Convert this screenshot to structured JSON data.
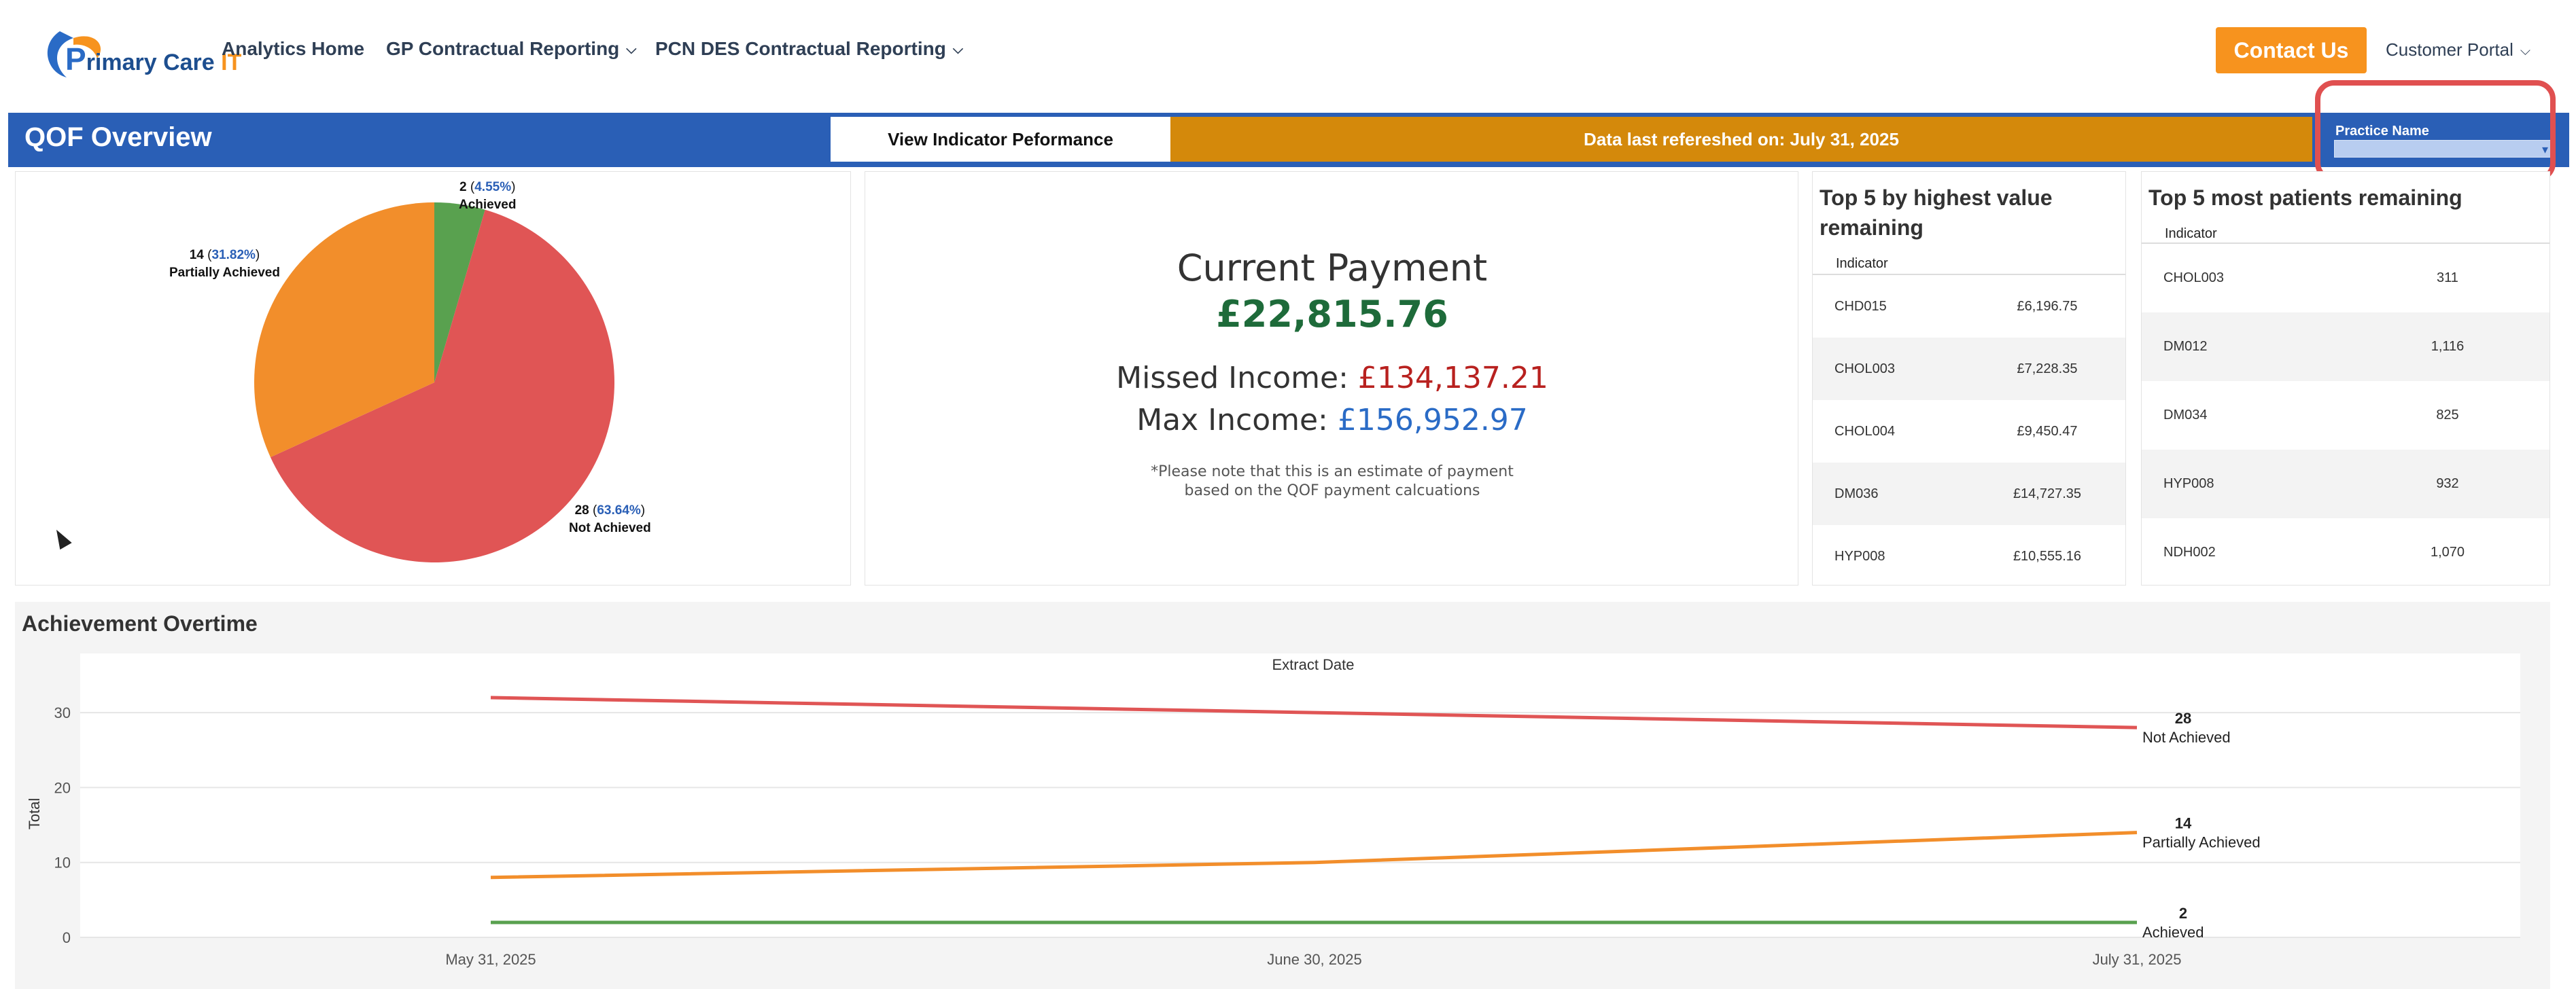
{
  "nav": {
    "logo_text": "rimary Care",
    "logo_it": "IT",
    "links": [
      "Analytics Home",
      "GP Contractual Reporting",
      "PCN DES Contractual Reporting"
    ],
    "contact_label": "Contact Us",
    "portal_label": "Customer Portal"
  },
  "banner": {
    "title": "QOF Overview",
    "view_button": "View Indicator Peformance",
    "refresh_text": "Data last refereshed on: July 31, 2025",
    "practice_label": "Practice Name",
    "practice_value": ""
  },
  "pie": {
    "achieved": {
      "count": "2",
      "pct": "4.55%",
      "label": "Achieved"
    },
    "partial": {
      "count": "14",
      "pct": "31.82%",
      "label": "Partially Achieved"
    },
    "not": {
      "count": "28",
      "pct": "63.64%",
      "label": "Not Achieved"
    }
  },
  "payment": {
    "current_label": "Current Payment",
    "current_value": "£22,815.76",
    "missed_label": "Missed Income: ",
    "missed_value": "£134,137.21",
    "max_label": "Max Income: ",
    "max_value": "£156,952.97",
    "note_line1": "*Please note that this is an estimate of payment",
    "note_line2": "based on the QOF payment calcuations"
  },
  "top5_value": {
    "title": "Top 5 by highest value remaining",
    "header": "Indicator",
    "rows": [
      {
        "indicator": "CHD015",
        "value": "£6,196.75"
      },
      {
        "indicator": "CHOL003",
        "value": "£7,228.35"
      },
      {
        "indicator": "CHOL004",
        "value": "£9,450.47"
      },
      {
        "indicator": "DM036",
        "value": "£14,727.35"
      },
      {
        "indicator": "HYP008",
        "value": "£10,555.16"
      }
    ]
  },
  "top5_patients": {
    "title": "Top 5 most patients remaining",
    "header": "Indicator",
    "rows": [
      {
        "indicator": "CHOL003",
        "value": "311"
      },
      {
        "indicator": "DM012",
        "value": "1,116"
      },
      {
        "indicator": "DM034",
        "value": "825"
      },
      {
        "indicator": "HYP008",
        "value": "932"
      },
      {
        "indicator": "NDH002",
        "value": "1,070"
      }
    ]
  },
  "achievement": {
    "title": "Achievement Overtime"
  },
  "colors": {
    "not_achieved": "#e05555",
    "partial": "#f28e2b",
    "achieved": "#59a14f",
    "banner": "#2a5fb6",
    "refresh": "#d4890b",
    "contact": "#f7931e"
  },
  "chart_data": {
    "type": "line",
    "title": "",
    "xlabel": "Extract Date",
    "ylabel": "Total",
    "x": [
      "May 31, 2025",
      "June 30, 2025",
      "July 31, 2025"
    ],
    "ylim": [
      0,
      33
    ],
    "yticks": [
      0,
      10,
      20,
      30
    ],
    "grid": true,
    "series": [
      {
        "name": "Not Achieved",
        "values": [
          32,
          30,
          28
        ],
        "end_label": "28",
        "color": "#e05555"
      },
      {
        "name": "Partially Achieved",
        "values": [
          8,
          10,
          14
        ],
        "end_label": "14",
        "color": "#f28e2b"
      },
      {
        "name": "Achieved",
        "values": [
          2,
          2,
          2
        ],
        "end_label": "2",
        "color": "#59a14f"
      }
    ]
  }
}
